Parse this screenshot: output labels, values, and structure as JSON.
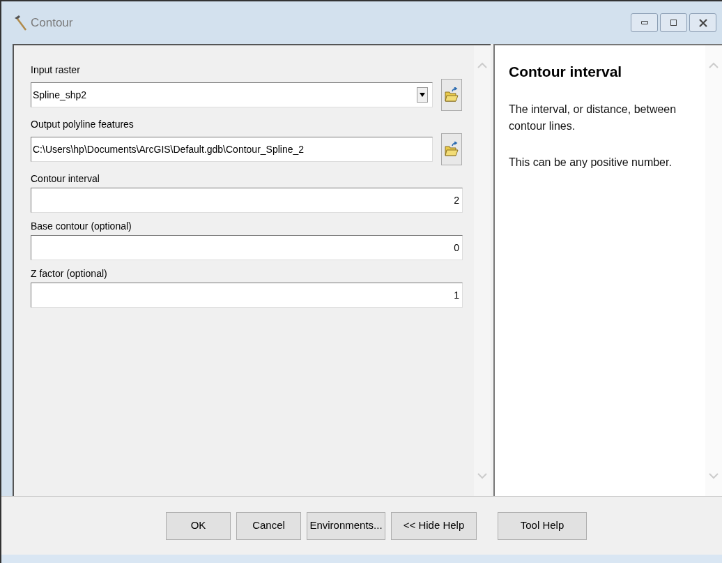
{
  "window": {
    "title": "Contour"
  },
  "fields": [
    {
      "label": "Input raster",
      "value": "Spline_shp2",
      "kind": "dropdown"
    },
    {
      "label": "Output polyline features",
      "value": "C:\\Users\\hp\\Documents\\ArcGIS\\Default.gdb\\Contour_Spline_2",
      "kind": "browse"
    },
    {
      "label": "Contour interval",
      "value": "2",
      "kind": "number"
    },
    {
      "label": "Base contour (optional)",
      "value": "0",
      "kind": "number"
    },
    {
      "label": "Z factor (optional)",
      "value": "1",
      "kind": "number"
    }
  ],
  "help": {
    "title": "Contour interval",
    "paragraphs": [
      "The interval, or distance, between contour lines.",
      "This can be any positive number."
    ]
  },
  "buttons": [
    "OK",
    "Cancel",
    "Environments...",
    "<< Hide Help",
    "Tool Help"
  ]
}
